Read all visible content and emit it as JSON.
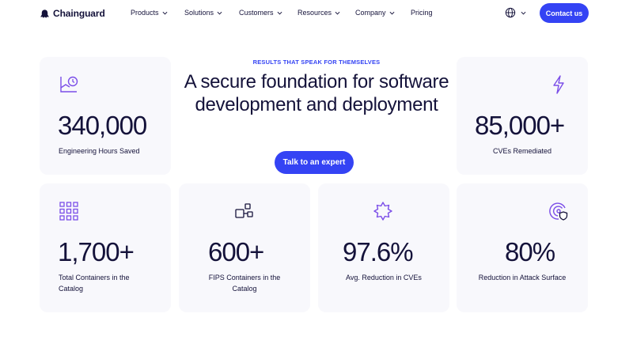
{
  "header": {
    "brand": "Chainguard",
    "nav": [
      {
        "label": "Products"
      },
      {
        "label": "Solutions"
      },
      {
        "label": "Customers"
      },
      {
        "label": "Resources"
      },
      {
        "label": "Company"
      },
      {
        "label": "Pricing"
      }
    ],
    "contact_label": "Contact us"
  },
  "hero": {
    "eyebrow": "RESULTS THAT SPEAK FOR THEMSELVES",
    "title": "A secure foundation for software development and deployment",
    "cta_label": "Talk to an expert"
  },
  "stats": [
    {
      "value": "340,000",
      "label": "Engineering Hours Saved",
      "icon": "chart-clock-icon"
    },
    {
      "value": "85,000+",
      "label": "CVEs Remediated",
      "icon": "lightning-icon"
    },
    {
      "value": "1,700+",
      "label": "Total Containers in the Catalog",
      "icon": "grid-icon"
    },
    {
      "value": "600+",
      "label": "FIPS Containers in the Catalog",
      "icon": "containers-icon"
    },
    {
      "value": "97.6%",
      "label": "Avg. Reduction in CVEs",
      "icon": "badge-star-icon"
    },
    {
      "value": "80%",
      "label": "Reduction in Attack Surface",
      "icon": "target-shield-icon"
    }
  ],
  "colors": {
    "accent": "#3443f4",
    "icon": "#7b4ee8",
    "text": "#14123a",
    "card_bg": "#f8f8fc"
  }
}
